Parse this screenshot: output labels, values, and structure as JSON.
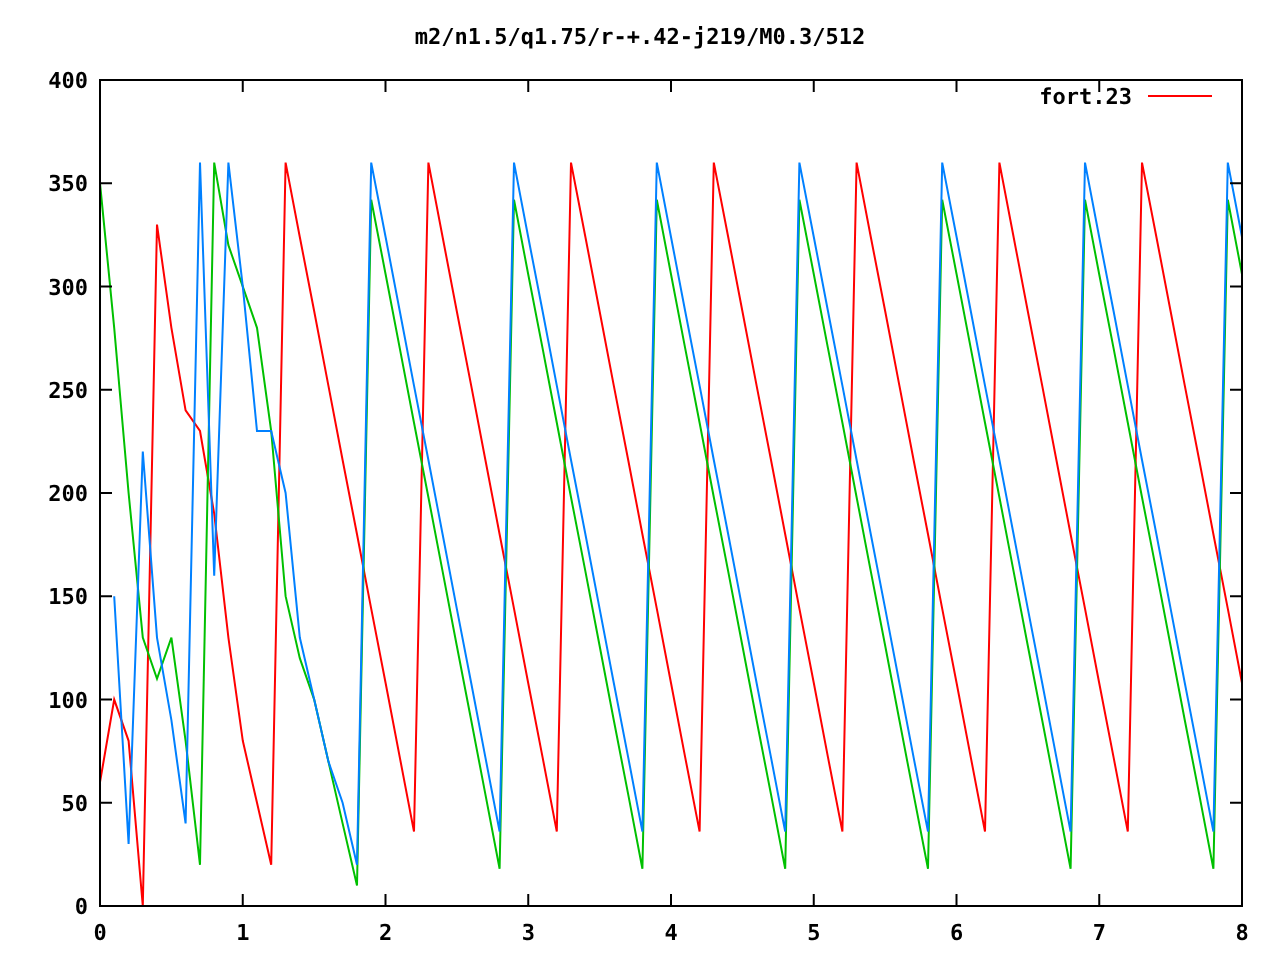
{
  "chart_data": {
    "type": "line",
    "title": "m2/n1.5/q1.75/r-+.42-j219/M0.3/512",
    "x": [
      0,
      0.1,
      0.2,
      0.3,
      0.4,
      0.5,
      0.6,
      0.7,
      0.8,
      0.9,
      1,
      1.1,
      1.2,
      1.3,
      1.4,
      1.5,
      1.6,
      1.7,
      1.8,
      1.9,
      2,
      2.1,
      2.2,
      2.3,
      2.4,
      2.5,
      2.6,
      2.7,
      2.8,
      2.9,
      3,
      3.1,
      3.2,
      3.3,
      3.4,
      3.5,
      3.6,
      3.7,
      3.8,
      3.9,
      4,
      4.1,
      4.2,
      4.3,
      4.4,
      4.5,
      4.6,
      4.7,
      4.8,
      4.9,
      5,
      5.1,
      5.2,
      5.3,
      5.4,
      5.5,
      5.6,
      5.7,
      5.8,
      5.9,
      6,
      6.1,
      6.2,
      6.3,
      6.4,
      6.5,
      6.6,
      6.7,
      6.8,
      6.9,
      7,
      7.1,
      7.2,
      7.3,
      7.4,
      7.5,
      7.6,
      7.7,
      7.8,
      7.9,
      8
    ],
    "series": [
      {
        "name": "fort.23",
        "color": "#ff0000",
        "values": [
          60,
          100,
          80,
          0,
          330,
          280,
          240,
          230,
          190,
          130,
          80,
          50,
          20,
          360,
          324,
          288,
          252,
          216,
          180,
          144,
          108,
          72,
          36,
          360,
          324,
          288,
          252,
          216,
          180,
          144,
          108,
          72,
          36,
          360,
          324,
          288,
          252,
          216,
          180,
          144,
          108,
          72,
          36,
          360,
          324,
          288,
          252,
          216,
          180,
          144,
          108,
          72,
          36,
          360,
          324,
          288,
          252,
          216,
          180,
          144,
          108,
          72,
          36,
          360,
          324,
          288,
          252,
          216,
          180,
          144,
          108,
          72,
          36,
          360,
          324,
          288,
          252,
          216,
          180,
          144,
          108
        ]
      },
      {
        "color": "#00c000",
        "values": [
          350,
          280,
          200,
          130,
          110,
          130,
          80,
          20,
          360,
          320,
          300,
          280,
          230,
          150,
          120,
          100,
          70,
          40,
          10,
          342,
          306,
          270,
          234,
          198,
          162,
          126,
          90,
          54,
          18,
          342,
          306,
          270,
          234,
          198,
          162,
          126,
          90,
          54,
          18,
          342,
          306,
          270,
          234,
          198,
          162,
          126,
          90,
          54,
          18,
          342,
          306,
          270,
          234,
          198,
          162,
          126,
          90,
          54,
          18,
          342,
          306,
          270,
          234,
          198,
          162,
          126,
          90,
          54,
          18,
          342,
          306,
          270,
          234,
          198,
          162,
          126,
          90,
          54,
          18,
          342,
          306
        ]
      },
      {
        "color": "#0080ff",
        "values": [
          null,
          150,
          30,
          220,
          130,
          90,
          40,
          360,
          160,
          360,
          300,
          230,
          230,
          200,
          130,
          100,
          70,
          50,
          20,
          360,
          324,
          288,
          252,
          216,
          180,
          144,
          108,
          72,
          36,
          360,
          324,
          288,
          252,
          216,
          180,
          144,
          108,
          72,
          36,
          360,
          324,
          288,
          252,
          216,
          180,
          144,
          108,
          72,
          36,
          360,
          324,
          288,
          252,
          216,
          180,
          144,
          108,
          72,
          36,
          360,
          324,
          288,
          252,
          216,
          180,
          144,
          108,
          72,
          36,
          360,
          324,
          288,
          252,
          216,
          180,
          144,
          108,
          72,
          36,
          360,
          324
        ]
      }
    ],
    "xlim": [
      0,
      8
    ],
    "ylim": [
      0,
      400
    ],
    "xticks": [
      0,
      1,
      2,
      3,
      4,
      5,
      6,
      7,
      8
    ],
    "yticks": [
      0,
      50,
      100,
      150,
      200,
      250,
      300,
      350,
      400
    ]
  }
}
